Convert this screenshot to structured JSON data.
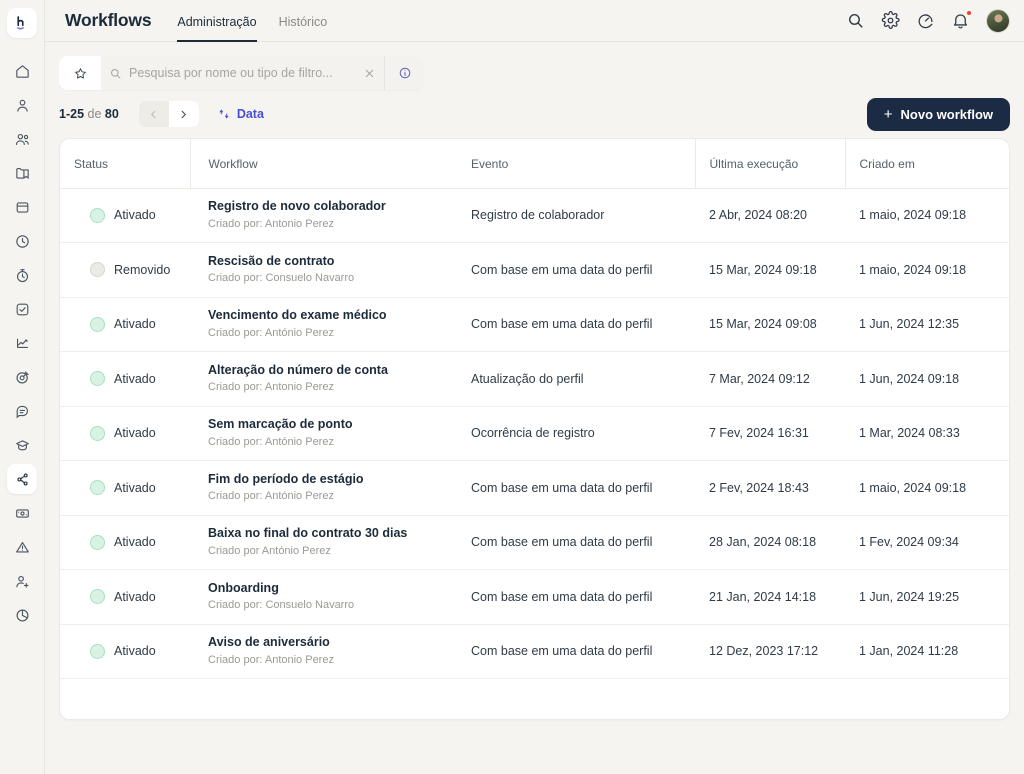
{
  "app": {
    "logo_alt": "logo-h"
  },
  "sidebar": {
    "items": [
      {
        "icon": "home-icon",
        "label": "Início",
        "active": false
      },
      {
        "icon": "person-icon",
        "label": "Perfil",
        "active": false
      },
      {
        "icon": "people-icon",
        "label": "Equipa",
        "active": false
      },
      {
        "icon": "folder-icon",
        "label": "Documentos",
        "active": false
      },
      {
        "icon": "box-icon",
        "label": "Arquivo",
        "active": false
      },
      {
        "icon": "clock-icon",
        "label": "Horas",
        "active": false
      },
      {
        "icon": "stopwatch-icon",
        "label": "Ponto",
        "active": false
      },
      {
        "icon": "task-check-icon",
        "label": "Tarefas",
        "active": false
      },
      {
        "icon": "chart-line-icon",
        "label": "Relatórios",
        "active": false
      },
      {
        "icon": "target-icon",
        "label": "Objetivos",
        "active": false
      },
      {
        "icon": "chat-icon",
        "label": "Mensagens",
        "active": false
      },
      {
        "icon": "graduation-cap-icon",
        "label": "Formação",
        "active": false
      },
      {
        "icon": "workflow-icon",
        "label": "Workflows",
        "active": true
      },
      {
        "icon": "money-icon",
        "label": "Pagamentos",
        "active": false
      },
      {
        "icon": "warning-icon",
        "label": "Alertas",
        "active": false
      },
      {
        "icon": "person-add-icon",
        "label": "Recrutamento",
        "active": false
      },
      {
        "icon": "pie-chart-icon",
        "label": "Análises",
        "active": false
      }
    ]
  },
  "header": {
    "title": "Workflows",
    "tabs": [
      {
        "label": "Administração",
        "active": true
      },
      {
        "label": "Histórico",
        "active": false
      }
    ],
    "actions": [
      {
        "name": "search-icon",
        "label": "Pesquisar"
      },
      {
        "name": "gear-icon",
        "label": "Definições"
      },
      {
        "name": "speedometer-icon",
        "label": "Desempenho"
      },
      {
        "name": "bell-icon",
        "label": "Notificações",
        "badge": true
      }
    ],
    "avatar_label": "Perfil do utilizador"
  },
  "search": {
    "placeholder": "Pesquisa por nome ou tipo de filtro...",
    "value": "",
    "star_label": "Favoritos",
    "clear_label": "Limpar",
    "info_label": "Informação"
  },
  "toolbar": {
    "range": "1-25",
    "of_word": "de",
    "total": "80",
    "prev_label": "Anterior",
    "next_label": "Seguinte",
    "sort_label": "Data",
    "new_button": "Novo workflow",
    "new_button_plus": "+"
  },
  "table": {
    "columns": [
      "Status",
      "Workflow",
      "Evento",
      "Última execução",
      "Criado em"
    ],
    "created_by_prefix": "Criado por:",
    "rows": [
      {
        "status": "Ativado",
        "status_state": "on",
        "name": "Registro de novo colaborador",
        "created_by": "Criado por: Antonio Perez",
        "event": "Registro de colaborador",
        "last_run": "2 Abr, 2024 08:20",
        "created_at": "1 maio, 2024 09:18"
      },
      {
        "status": "Removido",
        "status_state": "off",
        "name": "Rescisão de contrato",
        "created_by": "Criado por: Consuelo Navarro",
        "event": "Com base em uma data do perfil",
        "last_run": "15 Mar, 2024 09:18",
        "created_at": "1 maio, 2024 09:18"
      },
      {
        "status": "Ativado",
        "status_state": "on",
        "name": "Vencimento do exame médico",
        "created_by": "Criado por: António Perez",
        "event": "Com base em uma data do perfil",
        "last_run": "15 Mar, 2024 09:08",
        "created_at": "1 Jun, 2024 12:35"
      },
      {
        "status": "Ativado",
        "status_state": "on",
        "name": "Alteração do número de conta",
        "created_by": "Criado por: Antonio Perez",
        "event": "Atualização do perfil",
        "last_run": "7 Mar, 2024 09:12",
        "created_at": "1 Jun, 2024 09:18"
      },
      {
        "status": "Ativado",
        "status_state": "on",
        "name": "Sem marcação de ponto",
        "created_by": " Criado por: António Perez",
        "event": "Ocorrência de registro",
        "last_run": "7 Fev, 2024 16:31",
        "created_at": "1 Mar, 2024 08:33"
      },
      {
        "status": "Ativado",
        "status_state": "on",
        "name": "Fim do período de estágio",
        "created_by": "Criado por: António Perez",
        "event": "Com base em uma data do perfil",
        "last_run": "2 Fev, 2024 18:43",
        "created_at": "1 maio, 2024 09:18"
      },
      {
        "status": "Ativado",
        "status_state": "on",
        "name": "Baixa no final do contrato 30 dias",
        "created_by": "Criado por António Perez",
        "event": "Com base em uma data do perfil",
        "last_run": "28 Jan, 2024 08:18",
        "created_at": "1 Fev, 2024 09:34"
      },
      {
        "status": "Ativado",
        "status_state": "on",
        "name": "Onboarding",
        "created_by": "Criado por: Consuelo Navarro",
        "event": "Com base em uma data do perfil",
        "last_run": "21 Jan, 2024 14:18",
        "created_at": "1 Jun, 2024 19:25"
      },
      {
        "status": "Ativado",
        "status_state": "on",
        "name": "Aviso de aniversário",
        "created_by": "Criado por: Antonio Perez",
        "event": "Com base em uma data do perfil",
        "last_run": "12 Dez, 2023 17:12",
        "created_at": "1 Jan, 2024 11:28"
      }
    ]
  },
  "colors": {
    "page_bg": "#f5f4f0",
    "card_bg": "#ffffff",
    "accent_purple": "#4a4fcf",
    "button_dark": "#1c2b44",
    "status_on": "#d8f3e4",
    "status_off": "#eceae7",
    "badge_red": "#f0422a"
  }
}
